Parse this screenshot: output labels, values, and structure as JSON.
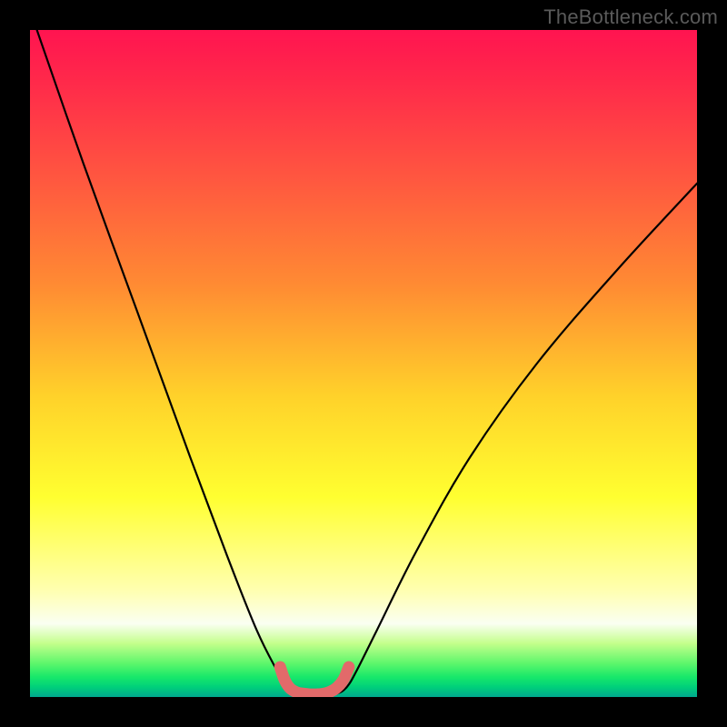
{
  "watermark": "TheBottleneck.com",
  "chart_data": {
    "type": "line",
    "title": "",
    "xlabel": "",
    "ylabel": "",
    "xlim": [
      0,
      100
    ],
    "ylim": [
      0,
      100
    ],
    "series": [
      {
        "name": "bottleneck-curve",
        "x": [
          0,
          8,
          16,
          24,
          30,
          34,
          37,
          38.5,
          40,
          42,
          44,
          46,
          47.5,
          49,
          52,
          58,
          66,
          76,
          88,
          100
        ],
        "y": [
          103,
          80,
          58,
          36,
          20,
          10,
          4,
          1.5,
          0.5,
          0.3,
          0.3,
          0.5,
          1.5,
          4,
          10,
          22,
          36,
          50,
          64,
          77
        ]
      },
      {
        "name": "bottom-highlight",
        "x": [
          37.5,
          38.2,
          39,
          40,
          41,
          42,
          43,
          44,
          45,
          46,
          47,
          47.8
        ],
        "y": [
          4.5,
          2.5,
          1.3,
          0.7,
          0.5,
          0.4,
          0.4,
          0.5,
          0.8,
          1.4,
          2.6,
          4.5
        ]
      }
    ],
    "highlight_color": "#e26a6a",
    "curve_color": "#000000"
  }
}
